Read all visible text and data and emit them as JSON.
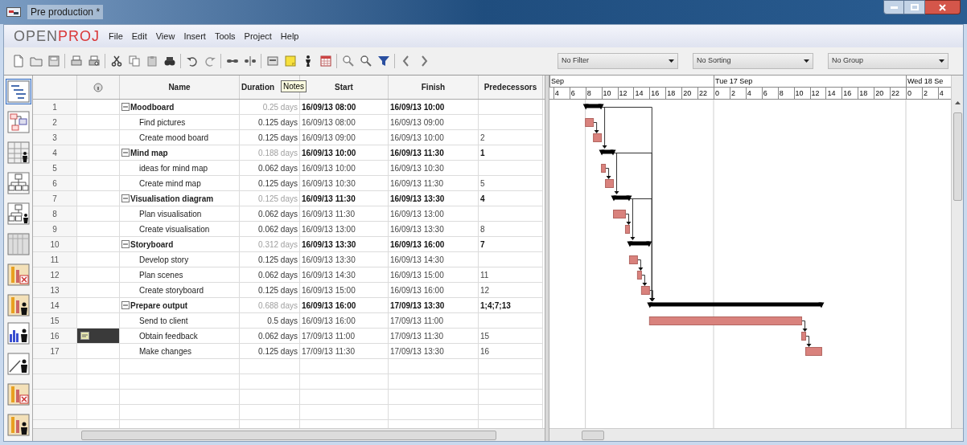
{
  "window": {
    "title": "Pre production *"
  },
  "logo": {
    "part_1": "OPEN",
    "part_2": "PROJ"
  },
  "menu": [
    "File",
    "Edit",
    "View",
    "Insert",
    "Tools",
    "Project",
    "Help"
  ],
  "toolbar": [
    {
      "kind": "new"
    },
    {
      "kind": "open"
    },
    {
      "kind": "save"
    },
    {
      "kind": "separator"
    },
    {
      "kind": "print"
    },
    {
      "kind": "preview"
    },
    {
      "kind": "separator"
    },
    {
      "kind": "cut"
    },
    {
      "kind": "copy"
    },
    {
      "kind": "paste"
    },
    {
      "kind": "find"
    },
    {
      "kind": "separator"
    },
    {
      "kind": "undo"
    },
    {
      "kind": "redo"
    },
    {
      "kind": "separator"
    },
    {
      "kind": "link"
    },
    {
      "kind": "unlink"
    },
    {
      "kind": "separator"
    },
    {
      "kind": "info"
    },
    {
      "kind": "notes"
    },
    {
      "kind": "resource"
    },
    {
      "kind": "calendar"
    },
    {
      "kind": "separator"
    },
    {
      "kind": "zoom-in"
    },
    {
      "kind": "zoom-out"
    },
    {
      "kind": "filter"
    },
    {
      "kind": "separator"
    },
    {
      "kind": "back"
    },
    {
      "kind": "forward"
    }
  ],
  "filters": [
    {
      "value": "No Filter"
    },
    {
      "value": "No Sorting"
    },
    {
      "value": "No Group"
    }
  ],
  "sidebar": {
    "top_views": [
      {
        "kind": "gantt",
        "selected": true
      },
      {
        "kind": "network",
        "selected": false
      },
      {
        "kind": "resources",
        "selected": false
      },
      {
        "kind": "wbs",
        "selected": false
      },
      {
        "kind": "rbs",
        "selected": false
      },
      {
        "kind": "grid",
        "selected": false
      },
      {
        "kind": "task-usage",
        "selected": false
      },
      {
        "kind": "resource-usage",
        "selected": false
      }
    ],
    "bottom_views": [
      {
        "kind": "histogram",
        "selected": false
      },
      {
        "kind": "charts",
        "selected": false
      },
      {
        "kind": "task-usage",
        "selected": false
      },
      {
        "kind": "resource-usage",
        "selected": false
      }
    ]
  },
  "table": {
    "columns": [
      "Name",
      "Duration",
      "Start",
      "Finish",
      "Predecessors"
    ],
    "tooltip": "Notes",
    "tasks": [
      {
        "id": "1",
        "name": "Moodboard",
        "duration": "0.25 days",
        "start": "16/09/13 08:00",
        "finish": "16/09/13 10:00",
        "expanded": true,
        "children": [
          {
            "id": "2",
            "name": "Find pictures",
            "duration": "0.125 days",
            "start": "16/09/13 08:00",
            "finish": "16/09/13 09:00",
            "note": false
          },
          {
            "id": "3",
            "name": "Create mood board",
            "duration": "0.125 days",
            "start": "16/09/13 09:00",
            "finish": "16/09/13 10:00",
            "predecessors": "2",
            "note": false
          }
        ]
      },
      {
        "id": "4",
        "name": "Mind map",
        "duration": "0.188 days",
        "start": "16/09/13 10:00",
        "finish": "16/09/13 11:30",
        "predecessors": "1",
        "expanded": true,
        "children": [
          {
            "id": "5",
            "name": "ideas for mind map",
            "duration": "0.062 days",
            "start": "16/09/13 10:00",
            "finish": "16/09/13 10:30",
            "note": false
          },
          {
            "id": "6",
            "name": "Create mind map",
            "duration": "0.125 days",
            "start": "16/09/13 10:30",
            "finish": "16/09/13 11:30",
            "predecessors": "5",
            "note": false
          }
        ]
      },
      {
        "id": "7",
        "name": "Visualisation diagram",
        "duration": "0.125 days",
        "start": "16/09/13 11:30",
        "finish": "16/09/13 13:30",
        "predecessors": "4",
        "expanded": true,
        "children": [
          {
            "id": "8",
            "name": "Plan visualisation",
            "duration": "0.062 days",
            "start": "16/09/13 11:30",
            "finish": "16/09/13 13:00",
            "note": false
          },
          {
            "id": "9",
            "name": "Create visualisation",
            "duration": "0.062 days",
            "start": "16/09/13 13:00",
            "finish": "16/09/13 13:30",
            "predecessors": "8",
            "note": false
          }
        ]
      },
      {
        "id": "10",
        "name": "Storyboard",
        "duration": "0.312 days",
        "start": "16/09/13 13:30",
        "finish": "16/09/13 16:00",
        "predecessors": "7",
        "expanded": true,
        "children": [
          {
            "id": "11",
            "name": "Develop story",
            "duration": "0.125 days",
            "start": "16/09/13 13:30",
            "finish": "16/09/13 14:30",
            "note": false
          },
          {
            "id": "12",
            "name": "Plan scenes",
            "duration": "0.062 days",
            "start": "16/09/13 14:30",
            "finish": "16/09/13 15:00",
            "predecessors": "11",
            "note": false
          },
          {
            "id": "13",
            "name": "Create storyboard",
            "duration": "0.125 days",
            "start": "16/09/13 15:00",
            "finish": "16/09/13 16:00",
            "predecessors": "12",
            "note": false
          }
        ]
      },
      {
        "id": "14",
        "name": "Prepare output",
        "duration": "0.688 days",
        "start": "16/09/13 16:00",
        "finish": "17/09/13 13:30",
        "predecessors": "1;4;7;13",
        "expanded": true,
        "children": [
          {
            "id": "15",
            "name": "Send to client",
            "duration": "0.5 days",
            "start": "16/09/13 16:00",
            "finish": "17/09/13 11:00",
            "note": false
          },
          {
            "id": "16",
            "name": "Obtain feedback",
            "duration": "0.062 days",
            "start": "17/09/13 11:00",
            "finish": "17/09/13 11:30",
            "predecessors": "15",
            "note": true
          },
          {
            "id": "17",
            "name": "Make changes",
            "duration": "0.125 days",
            "start": "17/09/13 11:30",
            "finish": "17/09/13 13:30",
            "predecessors": "16",
            "note": false
          }
        ]
      }
    ]
  },
  "gantt": {
    "day_labels": [
      "Sep",
      "Tue 17 Sep",
      "Wed 18 Se"
    ],
    "hour_labels": [
      "4",
      "6",
      "8",
      "10",
      "12",
      "14",
      "16",
      "18",
      "20",
      "22",
      "0",
      "2",
      "4",
      "6",
      "8",
      "10",
      "12",
      "14",
      "16",
      "18",
      "20",
      "22",
      "0",
      "2",
      "4"
    ]
  }
}
